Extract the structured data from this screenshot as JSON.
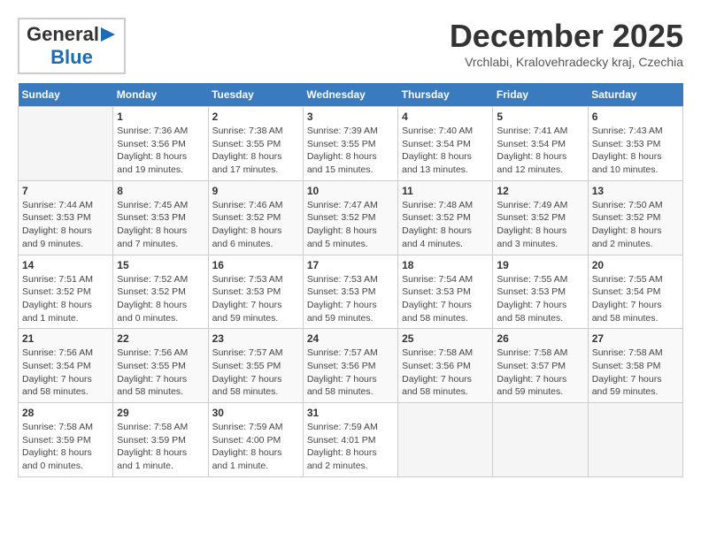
{
  "header": {
    "logo": {
      "general": "General",
      "blue": "Blue",
      "arrow": "▶"
    },
    "title": "December 2025",
    "location": "Vrchlabi, Kralovehradecky kraj, Czechia"
  },
  "calendar": {
    "days_of_week": [
      "Sunday",
      "Monday",
      "Tuesday",
      "Wednesday",
      "Thursday",
      "Friday",
      "Saturday"
    ],
    "weeks": [
      [
        {
          "day": "",
          "info": ""
        },
        {
          "day": "1",
          "info": "Sunrise: 7:36 AM\nSunset: 3:56 PM\nDaylight: 8 hours\nand 19 minutes."
        },
        {
          "day": "2",
          "info": "Sunrise: 7:38 AM\nSunset: 3:55 PM\nDaylight: 8 hours\nand 17 minutes."
        },
        {
          "day": "3",
          "info": "Sunrise: 7:39 AM\nSunset: 3:55 PM\nDaylight: 8 hours\nand 15 minutes."
        },
        {
          "day": "4",
          "info": "Sunrise: 7:40 AM\nSunset: 3:54 PM\nDaylight: 8 hours\nand 13 minutes."
        },
        {
          "day": "5",
          "info": "Sunrise: 7:41 AM\nSunset: 3:54 PM\nDaylight: 8 hours\nand 12 minutes."
        },
        {
          "day": "6",
          "info": "Sunrise: 7:43 AM\nSunset: 3:53 PM\nDaylight: 8 hours\nand 10 minutes."
        }
      ],
      [
        {
          "day": "7",
          "info": "Sunrise: 7:44 AM\nSunset: 3:53 PM\nDaylight: 8 hours\nand 9 minutes."
        },
        {
          "day": "8",
          "info": "Sunrise: 7:45 AM\nSunset: 3:53 PM\nDaylight: 8 hours\nand 7 minutes."
        },
        {
          "day": "9",
          "info": "Sunrise: 7:46 AM\nSunset: 3:52 PM\nDaylight: 8 hours\nand 6 minutes."
        },
        {
          "day": "10",
          "info": "Sunrise: 7:47 AM\nSunset: 3:52 PM\nDaylight: 8 hours\nand 5 minutes."
        },
        {
          "day": "11",
          "info": "Sunrise: 7:48 AM\nSunset: 3:52 PM\nDaylight: 8 hours\nand 4 minutes."
        },
        {
          "day": "12",
          "info": "Sunrise: 7:49 AM\nSunset: 3:52 PM\nDaylight: 8 hours\nand 3 minutes."
        },
        {
          "day": "13",
          "info": "Sunrise: 7:50 AM\nSunset: 3:52 PM\nDaylight: 8 hours\nand 2 minutes."
        }
      ],
      [
        {
          "day": "14",
          "info": "Sunrise: 7:51 AM\nSunset: 3:52 PM\nDaylight: 8 hours\nand 1 minute."
        },
        {
          "day": "15",
          "info": "Sunrise: 7:52 AM\nSunset: 3:52 PM\nDaylight: 8 hours\nand 0 minutes."
        },
        {
          "day": "16",
          "info": "Sunrise: 7:53 AM\nSunset: 3:53 PM\nDaylight: 7 hours\nand 59 minutes."
        },
        {
          "day": "17",
          "info": "Sunrise: 7:53 AM\nSunset: 3:53 PM\nDaylight: 7 hours\nand 59 minutes."
        },
        {
          "day": "18",
          "info": "Sunrise: 7:54 AM\nSunset: 3:53 PM\nDaylight: 7 hours\nand 58 minutes."
        },
        {
          "day": "19",
          "info": "Sunrise: 7:55 AM\nSunset: 3:53 PM\nDaylight: 7 hours\nand 58 minutes."
        },
        {
          "day": "20",
          "info": "Sunrise: 7:55 AM\nSunset: 3:54 PM\nDaylight: 7 hours\nand 58 minutes."
        }
      ],
      [
        {
          "day": "21",
          "info": "Sunrise: 7:56 AM\nSunset: 3:54 PM\nDaylight: 7 hours\nand 58 minutes."
        },
        {
          "day": "22",
          "info": "Sunrise: 7:56 AM\nSunset: 3:55 PM\nDaylight: 7 hours\nand 58 minutes."
        },
        {
          "day": "23",
          "info": "Sunrise: 7:57 AM\nSunset: 3:55 PM\nDaylight: 7 hours\nand 58 minutes."
        },
        {
          "day": "24",
          "info": "Sunrise: 7:57 AM\nSunset: 3:56 PM\nDaylight: 7 hours\nand 58 minutes."
        },
        {
          "day": "25",
          "info": "Sunrise: 7:58 AM\nSunset: 3:56 PM\nDaylight: 7 hours\nand 58 minutes."
        },
        {
          "day": "26",
          "info": "Sunrise: 7:58 AM\nSunset: 3:57 PM\nDaylight: 7 hours\nand 59 minutes."
        },
        {
          "day": "27",
          "info": "Sunrise: 7:58 AM\nSunset: 3:58 PM\nDaylight: 7 hours\nand 59 minutes."
        }
      ],
      [
        {
          "day": "28",
          "info": "Sunrise: 7:58 AM\nSunset: 3:59 PM\nDaylight: 8 hours\nand 0 minutes."
        },
        {
          "day": "29",
          "info": "Sunrise: 7:58 AM\nSunset: 3:59 PM\nDaylight: 8 hours\nand 1 minute."
        },
        {
          "day": "30",
          "info": "Sunrise: 7:59 AM\nSunset: 4:00 PM\nDaylight: 8 hours\nand 1 minute."
        },
        {
          "day": "31",
          "info": "Sunrise: 7:59 AM\nSunset: 4:01 PM\nDaylight: 8 hours\nand 2 minutes."
        },
        {
          "day": "",
          "info": ""
        },
        {
          "day": "",
          "info": ""
        },
        {
          "day": "",
          "info": ""
        }
      ]
    ]
  }
}
